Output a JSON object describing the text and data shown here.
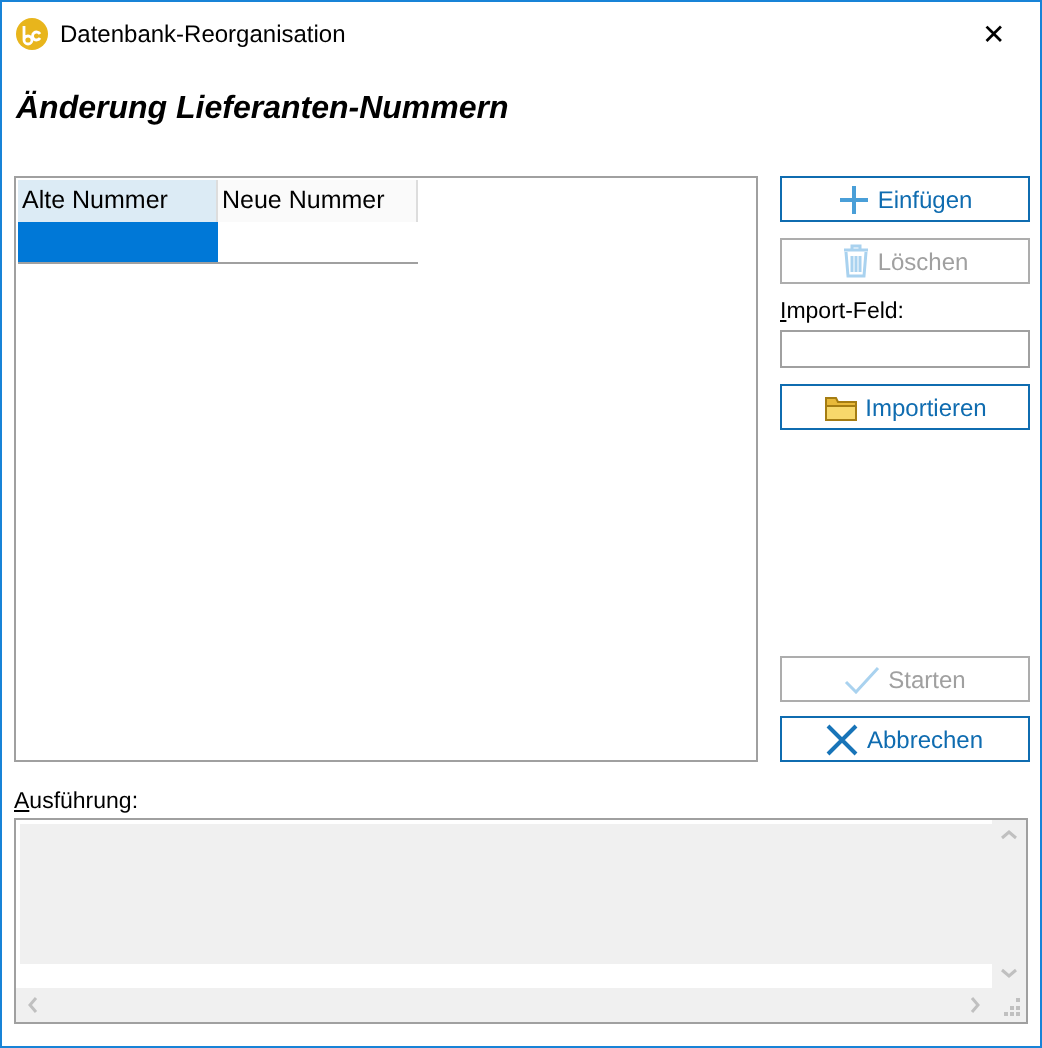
{
  "window": {
    "title": "Datenbank-Reorganisation",
    "close": "✕"
  },
  "heading": "Änderung Lieferanten-Nummern",
  "table": {
    "columns": [
      {
        "label": "Alte Nummer",
        "selected": true
      },
      {
        "label": "Neue Nummer",
        "selected": false
      }
    ],
    "rows": [
      {
        "cells": [
          {
            "selected": true
          },
          {
            "selected": false
          }
        ]
      }
    ]
  },
  "actions": [
    {
      "kind": "add",
      "label": "Einfügen",
      "disabled": false
    },
    {
      "kind": "delete",
      "label": "Löschen",
      "disabled": true
    }
  ],
  "import_field": {
    "label": "Import-Feld:"
  },
  "import_button": {
    "kind": "folder",
    "label": "Importieren",
    "disabled": false
  },
  "run_buttons": [
    {
      "kind": "check",
      "label": "Starten",
      "disabled": true
    },
    {
      "kind": "cancel",
      "label": "Abbrechen",
      "disabled": false
    }
  ],
  "log": {
    "label": "Ausführung:"
  }
}
